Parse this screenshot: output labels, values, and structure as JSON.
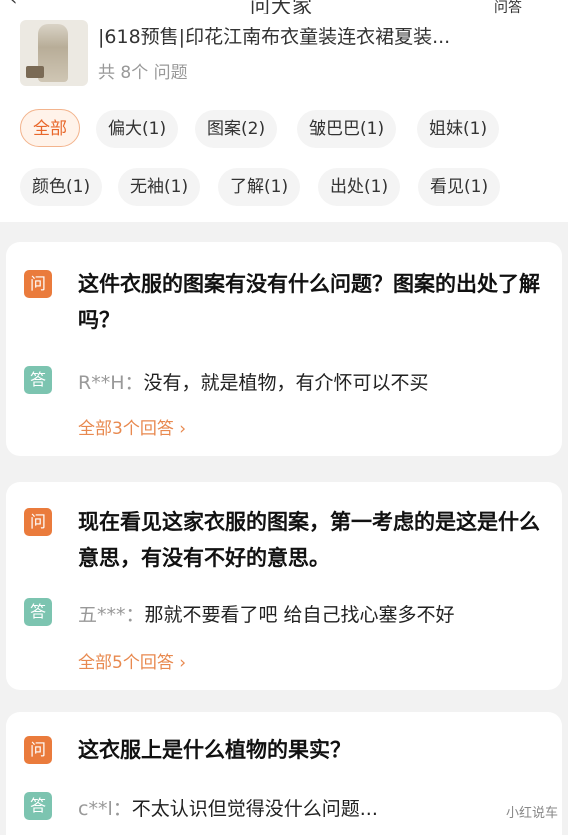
{
  "header": {
    "title": "问大家",
    "answer_label": "问答"
  },
  "product": {
    "title": "|618预售|印花江南布衣童装连衣裙夏装...",
    "question_count": "共 8个 问题"
  },
  "tags": [
    {
      "label": "全部",
      "active": true
    },
    {
      "label": "偏大(1)"
    },
    {
      "label": "图案(2)"
    },
    {
      "label": "皱巴巴(1)"
    },
    {
      "label": "姐妹(1)"
    },
    {
      "label": "颜色(1)"
    },
    {
      "label": "无袖(1)"
    },
    {
      "label": "了解(1)"
    },
    {
      "label": "出处(1)"
    },
    {
      "label": "看见(1)"
    }
  ],
  "badges": {
    "question": "问",
    "answer": "答"
  },
  "qa": [
    {
      "question": "这件衣服的图案有没有什么问题？图案的出处了解吗？",
      "user": "R**H：",
      "answer": "没有，就是植物，有介怀可以不买",
      "more": "全部3个回答 ›"
    },
    {
      "question": "现在看见这家衣服的图案，第一考虑的是这是什么意思，有没有不好的意思。",
      "user": "五***：",
      "answer": "那就不要看了吧  给自己找心塞多不好",
      "more": "全部5个回答 ›"
    },
    {
      "question": "这衣服上是什么植物的果实？",
      "user": "c**l：",
      "answer": "不太认识但觉得没什么问题..."
    }
  ],
  "watermark": "小红说车"
}
